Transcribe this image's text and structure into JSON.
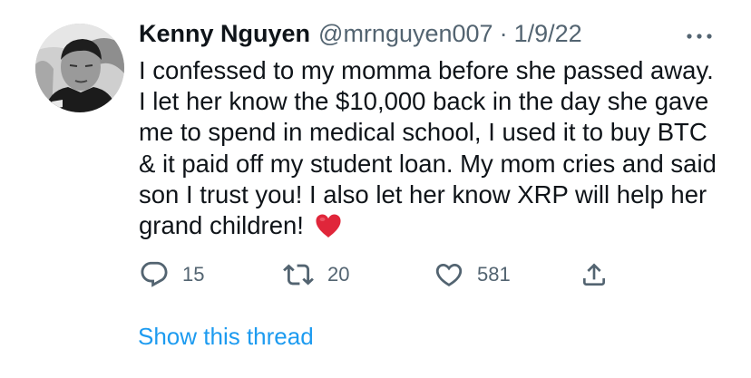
{
  "tweet": {
    "author_name": "Kenny Nguyen",
    "handle": "@mrnguyen007",
    "separator": "·",
    "date": "1/9/22",
    "text": "I confessed to my momma before she passed away. I let her know the $10,000 back in the day she gave me to spend in medical school, I used it to buy BTC & it paid off my student loan. My mom cries and said son I trust you! I also let her know XRP will help her grand children! ",
    "emoji": "red-heart"
  },
  "actions": {
    "reply": {
      "icon": "reply-icon",
      "count": "15"
    },
    "retweet": {
      "icon": "retweet-icon",
      "count": "20"
    },
    "like": {
      "icon": "like-icon",
      "count": "581"
    },
    "share": {
      "icon": "share-icon"
    }
  },
  "show_thread_label": "Show this thread",
  "colors": {
    "text": "#0f1419",
    "secondary": "#536471",
    "link": "#1d9bf0",
    "emoji_heart": "#e0263a"
  }
}
